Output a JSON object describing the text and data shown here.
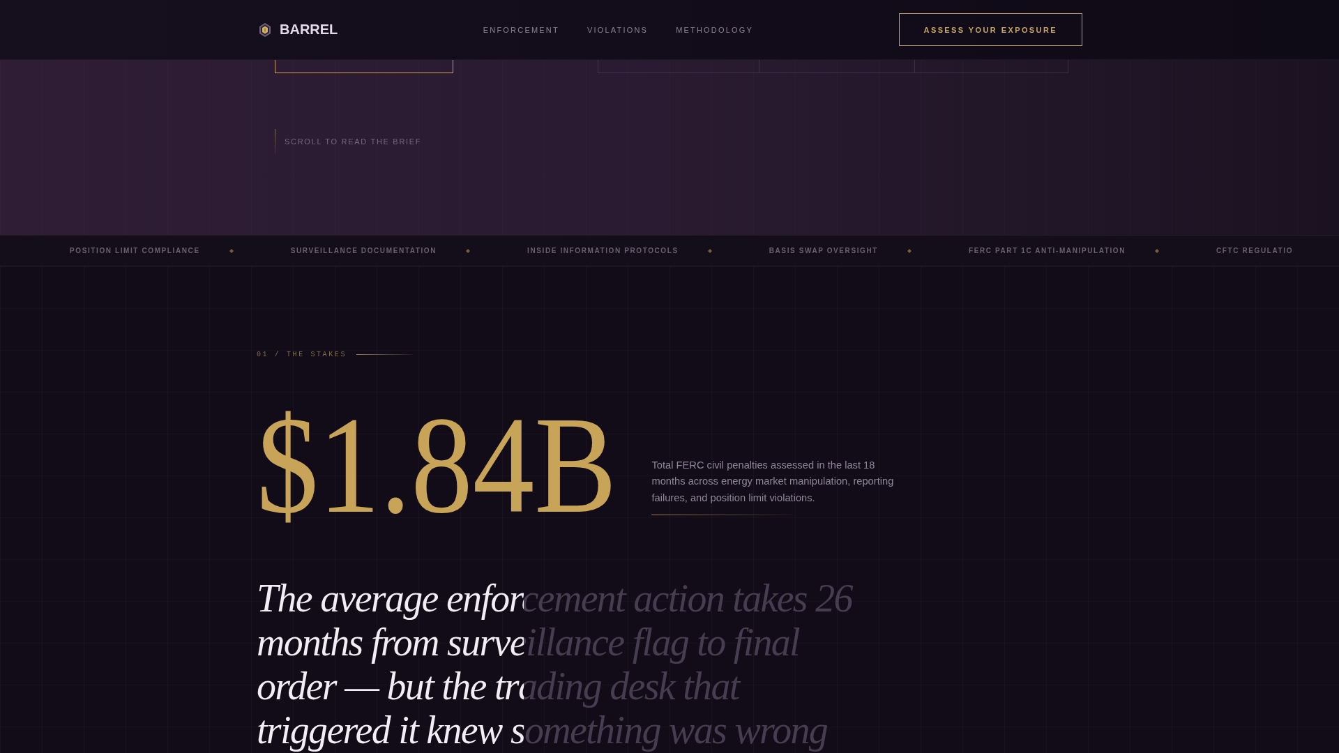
{
  "header": {
    "brand": "BARREL",
    "nav": [
      {
        "label": "ENFORCEMENT"
      },
      {
        "label": "VIOLATIONS"
      },
      {
        "label": "METHODOLOGY"
      }
    ],
    "cta": "ASSESS YOUR EXPOSURE"
  },
  "hero": {
    "scroll_hint": "SCROLL TO READ THE BRIEF"
  },
  "ticker": [
    "POSITION LIMIT COMPLIANCE",
    "SURVEILLANCE DOCUMENTATION",
    "INSIDE INFORMATION PROTOCOLS",
    "BASIS SWAP OVERSIGHT",
    "FERC PART 1C ANTI-MANIPULATION",
    "CFTC REGULATIO"
  ],
  "stakes": {
    "label": "01 / THE STAKES",
    "figure": "$1.84B",
    "description": "Total FERC civil penalties assessed in the last 18 months across energy market manipulation, reporting failures, and position limit violations.",
    "quote": {
      "text": "The average enforcement action takes 26 months from surveillance flag to final order — but the trading desk that triggered it knew something was wrong",
      "level": 0.43
    }
  }
}
